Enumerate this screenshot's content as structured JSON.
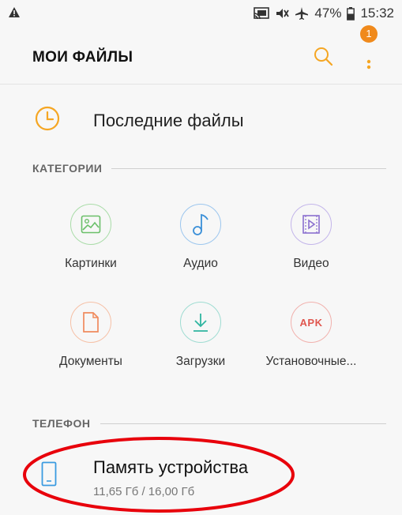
{
  "status_bar": {
    "battery_percent": "47%",
    "time": "15:32",
    "icons": [
      "warning-icon",
      "cast-icon",
      "mute-icon",
      "airplane-icon",
      "battery-icon"
    ]
  },
  "header": {
    "title": "МОИ ФАЙЛЫ",
    "notification_count": "1"
  },
  "recent": {
    "label": "Последние файлы",
    "icon": "clock-icon"
  },
  "categories_section": {
    "title": "КАТЕГОРИИ",
    "items": [
      {
        "label": "Картинки",
        "icon": "image-icon",
        "color": "#6abf69"
      },
      {
        "label": "Аудио",
        "icon": "music-note-icon",
        "color": "#3a8fd8"
      },
      {
        "label": "Видео",
        "icon": "video-icon",
        "color": "#8a6fcf"
      },
      {
        "label": "Документы",
        "icon": "document-icon",
        "color": "#f08a5d"
      },
      {
        "label": "Загрузки",
        "icon": "download-icon",
        "color": "#2fb5a0"
      },
      {
        "label": "Установочные...",
        "icon": "apk-icon",
        "icon_text": "APK",
        "color": "#e0574f"
      }
    ]
  },
  "phone_section": {
    "title": "ТЕЛЕФОН",
    "storage": {
      "title": "Память устройства",
      "usage": "11,65 Гб / 16,00 Гб",
      "icon": "phone-icon"
    }
  },
  "colors": {
    "accent": "#f5a623",
    "badge": "#f08a1c",
    "annotation": "#e8000b",
    "storage_icon": "#3a9be0"
  }
}
